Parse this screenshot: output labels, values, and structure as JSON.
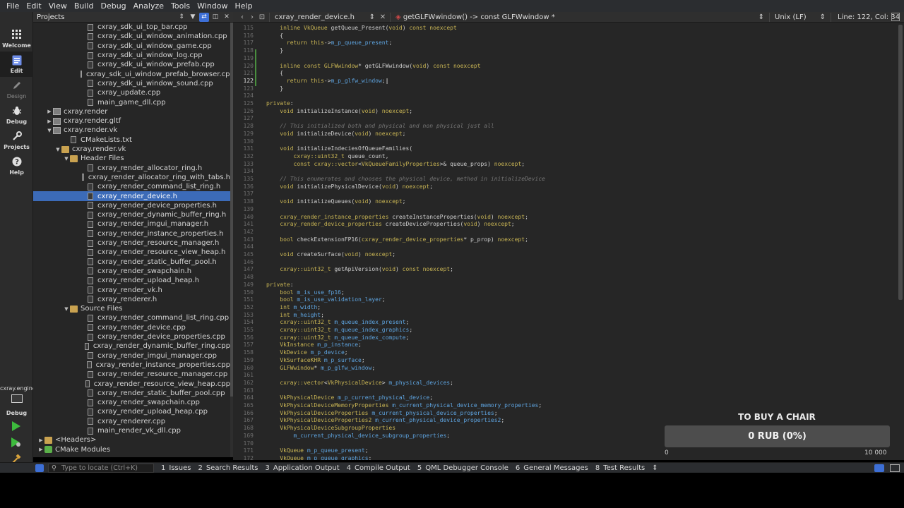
{
  "menubar": [
    "File",
    "Edit",
    "View",
    "Build",
    "Debug",
    "Analyze",
    "Tools",
    "Window",
    "Help"
  ],
  "modes": {
    "welcome": "Welcome",
    "edit": "Edit",
    "design": "Design",
    "debug": "Debug",
    "projects": "Projects",
    "help": "Help",
    "kit_name": "cxray.engine",
    "kit_mode": "Debug"
  },
  "projects_pane": {
    "title": "Projects",
    "items": [
      {
        "label": "cxray_sdk_ui_top_bar.cpp",
        "indent": 6,
        "icon": "file"
      },
      {
        "label": "cxray_sdk_ui_window_animation.cpp",
        "indent": 6,
        "icon": "file"
      },
      {
        "label": "cxray_sdk_ui_window_game.cpp",
        "indent": 6,
        "icon": "file"
      },
      {
        "label": "cxray_sdk_ui_window_log.cpp",
        "indent": 6,
        "icon": "file"
      },
      {
        "label": "cxray_sdk_ui_window_prefab.cpp",
        "indent": 6,
        "icon": "file"
      },
      {
        "label": "cxray_sdk_ui_window_prefab_browser.cpp",
        "indent": 6,
        "icon": "file"
      },
      {
        "label": "cxray_sdk_ui_window_sound.cpp",
        "indent": 6,
        "icon": "file"
      },
      {
        "label": "cxray_update.cpp",
        "indent": 6,
        "icon": "file"
      },
      {
        "label": "main_game_dll.cpp",
        "indent": 6,
        "icon": "file"
      },
      {
        "label": "cxray.render",
        "indent": 2,
        "icon": "proj",
        "arrow": "▶"
      },
      {
        "label": "cxray.render.gltf",
        "indent": 2,
        "icon": "proj",
        "arrow": "▶"
      },
      {
        "label": "cxray.render.vk",
        "indent": 2,
        "icon": "proj",
        "arrow": "▼"
      },
      {
        "label": "CMakeLists.txt",
        "indent": 4,
        "icon": "file"
      },
      {
        "label": "cxray.render.vk",
        "indent": 3,
        "icon": "folder",
        "arrow": "▼"
      },
      {
        "label": "Header Files",
        "indent": 4,
        "icon": "folder",
        "arrow": "▼"
      },
      {
        "label": "cxray_render_allocator_ring.h",
        "indent": 6,
        "icon": "file"
      },
      {
        "label": "cxray_render_allocator_ring_with_tabs.h",
        "indent": 6,
        "icon": "file"
      },
      {
        "label": "cxray_render_command_list_ring.h",
        "indent": 6,
        "icon": "file"
      },
      {
        "label": "cxray_render_device.h",
        "indent": 6,
        "icon": "file",
        "selected": true
      },
      {
        "label": "cxray_render_device_properties.h",
        "indent": 6,
        "icon": "file"
      },
      {
        "label": "cxray_render_dynamic_buffer_ring.h",
        "indent": 6,
        "icon": "file"
      },
      {
        "label": "cxray_render_imgui_manager.h",
        "indent": 6,
        "icon": "file"
      },
      {
        "label": "cxray_render_instance_properties.h",
        "indent": 6,
        "icon": "file"
      },
      {
        "label": "cxray_render_resource_manager.h",
        "indent": 6,
        "icon": "file"
      },
      {
        "label": "cxray_render_resource_view_heap.h",
        "indent": 6,
        "icon": "file"
      },
      {
        "label": "cxray_render_static_buffer_pool.h",
        "indent": 6,
        "icon": "file"
      },
      {
        "label": "cxray_render_swapchain.h",
        "indent": 6,
        "icon": "file"
      },
      {
        "label": "cxray_render_upload_heap.h",
        "indent": 6,
        "icon": "file"
      },
      {
        "label": "cxray_render_vk.h",
        "indent": 6,
        "icon": "file"
      },
      {
        "label": "cxray_renderer.h",
        "indent": 6,
        "icon": "file"
      },
      {
        "label": "Source Files",
        "indent": 4,
        "icon": "folder",
        "arrow": "▼"
      },
      {
        "label": "cxray_render_command_list_ring.cpp",
        "indent": 6,
        "icon": "file"
      },
      {
        "label": "cxray_render_device.cpp",
        "indent": 6,
        "icon": "file"
      },
      {
        "label": "cxray_render_device_properties.cpp",
        "indent": 6,
        "icon": "file"
      },
      {
        "label": "cxray_render_dynamic_buffer_ring.cpp",
        "indent": 6,
        "icon": "file"
      },
      {
        "label": "cxray_render_imgui_manager.cpp",
        "indent": 6,
        "icon": "file"
      },
      {
        "label": "cxray_render_instance_properties.cpp",
        "indent": 6,
        "icon": "file"
      },
      {
        "label": "cxray_render_resource_manager.cpp",
        "indent": 6,
        "icon": "file"
      },
      {
        "label": "cxray_render_resource_view_heap.cpp",
        "indent": 6,
        "icon": "file"
      },
      {
        "label": "cxray_render_static_buffer_pool.cpp",
        "indent": 6,
        "icon": "file"
      },
      {
        "label": "cxray_render_swapchain.cpp",
        "indent": 6,
        "icon": "file"
      },
      {
        "label": "cxray_render_upload_heap.cpp",
        "indent": 6,
        "icon": "file"
      },
      {
        "label": "cxray_renderer.cpp",
        "indent": 6,
        "icon": "file"
      },
      {
        "label": "main_render_vk_dll.cpp",
        "indent": 6,
        "icon": "file"
      },
      {
        "label": "<Headers>",
        "indent": 1,
        "icon": "folder",
        "arrow": "▶"
      },
      {
        "label": "CMake Modules",
        "indent": 1,
        "icon": "green",
        "arrow": "▶"
      }
    ]
  },
  "editor": {
    "file_name": "cxray_render_device.h",
    "symbol": "getGLFWwindow() -> const GLFWwindow *",
    "line_ending": "Unix (LF)",
    "cursor": "Line: 122, Col: 34",
    "current_line": 122,
    "lines": [
      {
        "n": 115,
        "t": "    inline VkQueue getQueue_Present(void) const noexcept"
      },
      {
        "n": 116,
        "t": "    {"
      },
      {
        "n": 117,
        "t": "      return this->m_p_queue_present;"
      },
      {
        "n": 118,
        "t": "    }"
      },
      {
        "n": 119,
        "t": ""
      },
      {
        "n": 120,
        "t": "    inline const GLFWwindow* getGLFWwindow(void) const noexcept"
      },
      {
        "n": 121,
        "t": "    {"
      },
      {
        "n": 122,
        "t": "      return this->m_p_glfw_window;|"
      },
      {
        "n": 123,
        "t": "    }"
      },
      {
        "n": 124,
        "t": ""
      },
      {
        "n": 125,
        "t": "private:"
      },
      {
        "n": 126,
        "t": "    void initializeInstance(void) noexcept;"
      },
      {
        "n": 127,
        "t": ""
      },
      {
        "n": 128,
        "t": "    // This initialized both and physical and non physical just all"
      },
      {
        "n": 129,
        "t": "    void initializeDevice(void) noexcept;"
      },
      {
        "n": 130,
        "t": ""
      },
      {
        "n": 131,
        "t": "    void initializeIndeciesOfQueueFamilies("
      },
      {
        "n": 132,
        "t": "        cxray::uint32_t queue_count,"
      },
      {
        "n": 133,
        "t": "        const cxray::vector<VkQueueFamilyProperties>& queue_props) noexcept;"
      },
      {
        "n": 134,
        "t": ""
      },
      {
        "n": 135,
        "t": "    // This enumerates and chooses the physical device, method in initializeDevice"
      },
      {
        "n": 136,
        "t": "    void initializePhysicalDevice(void) noexcept;"
      },
      {
        "n": 137,
        "t": ""
      },
      {
        "n": 138,
        "t": "    void initializeQueues(void) noexcept;"
      },
      {
        "n": 139,
        "t": ""
      },
      {
        "n": 140,
        "t": "    cxray_render_instance_properties createInstanceProperties(void) noexcept;"
      },
      {
        "n": 141,
        "t": "    cxray_render_device_properties createDeviceProperties(void) noexcept;"
      },
      {
        "n": 142,
        "t": ""
      },
      {
        "n": 143,
        "t": "    bool checkExtensionFP16(cxray_render_device_properties* p_prop) noexcept;"
      },
      {
        "n": 144,
        "t": ""
      },
      {
        "n": 145,
        "t": "    void createSurface(void) noexcept;"
      },
      {
        "n": 146,
        "t": ""
      },
      {
        "n": 147,
        "t": "    cxray::uint32_t getApiVersion(void) const noexcept;"
      },
      {
        "n": 148,
        "t": ""
      },
      {
        "n": 149,
        "t": "private:"
      },
      {
        "n": 150,
        "t": "    bool m_is_use_fp16;"
      },
      {
        "n": 151,
        "t": "    bool m_is_use_validation_layer;"
      },
      {
        "n": 152,
        "t": "    int m_width;"
      },
      {
        "n": 153,
        "t": "    int m_height;"
      },
      {
        "n": 154,
        "t": "    cxray::uint32_t m_queue_index_present;"
      },
      {
        "n": 155,
        "t": "    cxray::uint32_t m_queue_index_graphics;"
      },
      {
        "n": 156,
        "t": "    cxray::uint32_t m_queue_index_compute;"
      },
      {
        "n": 157,
        "t": "    VkInstance m_p_instance;"
      },
      {
        "n": 158,
        "t": "    VkDevice m_p_device;"
      },
      {
        "n": 159,
        "t": "    VkSurfaceKHR m_p_surface;"
      },
      {
        "n": 160,
        "t": "    GLFWwindow* m_p_glfw_window;"
      },
      {
        "n": 161,
        "t": ""
      },
      {
        "n": 162,
        "t": "    cxray::vector<VkPhysicalDevice> m_physical_devices;"
      },
      {
        "n": 163,
        "t": ""
      },
      {
        "n": 164,
        "t": "    VkPhysicalDevice m_p_current_physical_device;"
      },
      {
        "n": 165,
        "t": "    VkPhysicalDeviceMemoryProperties m_current_physical_device_memory_properties;"
      },
      {
        "n": 166,
        "t": "    VkPhysicalDeviceProperties m_current_physical_device_properties;"
      },
      {
        "n": 167,
        "t": "    VkPhysicalDeviceProperties2 m_current_physical_device_properties2;"
      },
      {
        "n": 168,
        "t": "    VkPhysicalDeviceSubgroupProperties"
      },
      {
        "n": 169,
        "t": "        m_current_physical_device_subgroup_properties;"
      },
      {
        "n": 170,
        "t": ""
      },
      {
        "n": 171,
        "t": "    VkQueue m_p_queue_present;"
      },
      {
        "n": 172,
        "t": "    VkQueue m_p_queue_graphics;"
      }
    ]
  },
  "donation": {
    "title": "TO BUY A CHAIR",
    "amount": "0 RUB (0%)",
    "min": "0",
    "max": "10 000",
    "progress": 0
  },
  "statusbar": {
    "locator_placeholder": "Type to locate (Ctrl+K)",
    "tabs": [
      {
        "num": "1",
        "label": "Issues"
      },
      {
        "num": "2",
        "label": "Search Results"
      },
      {
        "num": "3",
        "label": "Application Output"
      },
      {
        "num": "4",
        "label": "Compile Output"
      },
      {
        "num": "5",
        "label": "QML Debugger Console"
      },
      {
        "num": "6",
        "label": "General Messages"
      },
      {
        "num": "8",
        "label": "Test Results"
      }
    ]
  },
  "colors": {
    "accent": "#3d6fd6",
    "selection": "#3c6bb8",
    "keyword": "#c9b554",
    "member": "#5ea4e0",
    "comment": "#767676"
  }
}
